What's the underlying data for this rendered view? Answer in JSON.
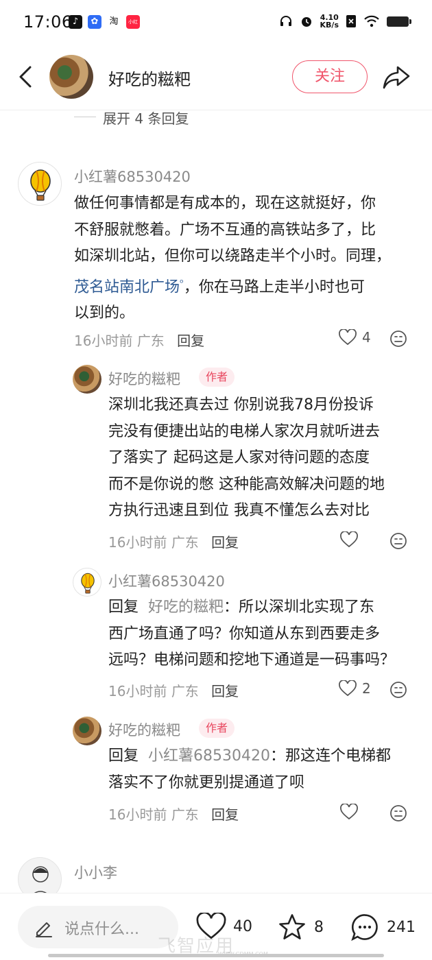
{
  "status_bar": {
    "time": "17:06",
    "app_icons": [
      "tiktok-icon",
      "baidu-icon",
      "taobao-icon",
      "xiaohongshu-icon"
    ],
    "taobao_label": "淘",
    "xhs_label": "小红书",
    "net_speed_value": "4.10",
    "net_speed_unit": "KB/s"
  },
  "header": {
    "author_name": "好吃的糍粑",
    "follow_label": "关注"
  },
  "expand_replies": "展开 4 条回复",
  "comments": [
    {
      "user": "小红薯68530420",
      "lines": [
        "做任何事情都是有成本的，现在这就挺好，你",
        "不舒服就憋着。广场不互通的高铁站多了，比",
        "如深圳北站，但你可以绕路走半个小时。同理，",
        "，你在马路上走半小时也可",
        "以到的。"
      ],
      "link_text": "茂名站南北广场",
      "time": "16小时前",
      "location": "广东",
      "reply_label": "回复",
      "likes": "4"
    },
    {
      "user": "好吃的糍粑",
      "author_tag": "作者",
      "lines": [
        "深圳北我还真去过 你别说我78月份投诉",
        "完没有便捷出站的电梯人家次月就听进去",
        "了落实了 起码这是人家对待问题的态度",
        "而不是你说的憋 这种能高效解决问题的地",
        "方执行迅速且到位 我真不懂怎么去对比"
      ],
      "time": "16小时前",
      "location": "广东",
      "reply_label": "回复",
      "likes": ""
    },
    {
      "user": "小红薯68530420",
      "reply_prefix": "回复",
      "reply_target": "好吃的糍粑",
      "lines": [
        "：所以深圳北实现了东",
        "西广场直通了吗？你知道从东到西要走多",
        "远吗？电梯问题和挖地下通道是一码事吗？"
      ],
      "time": "16小时前",
      "location": "广东",
      "reply_label": "回复",
      "likes": "2"
    },
    {
      "user": "好吃的糍粑",
      "author_tag": "作者",
      "reply_prefix": "回复",
      "reply_target": "小红薯68530420",
      "lines": [
        "：那这连个电梯都",
        "落实不了你就更别提通道了呗"
      ],
      "time": "16小时前",
      "location": "广东",
      "reply_label": "回复",
      "likes": ""
    },
    {
      "user": "小小李"
    }
  ],
  "bottom_bar": {
    "input_placeholder": "说点什么...",
    "likes": "40",
    "collects": "8",
    "comments": "241"
  },
  "watermark": "飞智应用",
  "watermark_sub": "WWW.GDMM.COM",
  "colors": {
    "accent": "#f0556b",
    "link": "#2e5a93",
    "meta_gray": "#999999"
  }
}
